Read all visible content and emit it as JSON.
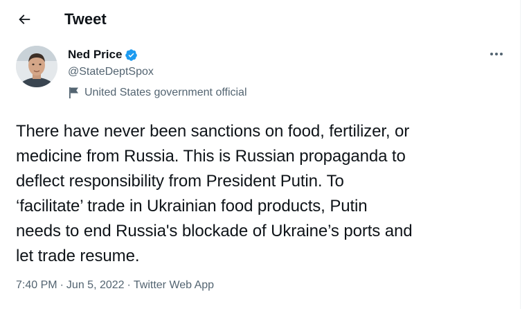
{
  "header": {
    "title": "Tweet"
  },
  "author": {
    "name": "Ned Price",
    "handle": "@StateDeptSpox",
    "label": "United States government official"
  },
  "tweet": {
    "text": "There have never been sanctions on food, fertilizer, or\nmedicine from Russia. This is Russian propaganda to\ndeflect responsibility from President Putin. To\n‘facilitate’ trade in Ukrainian food products, Putin\nneeds to end Russia's blockade of Ukraine’s ports and\nlet trade resume.",
    "time": "7:40 PM",
    "date": "Jun 5, 2022",
    "source": "Twitter Web App",
    "separator": "·"
  },
  "icons": {
    "back": "arrow-left-icon",
    "verified": "verified-badge-icon",
    "flag": "flag-icon",
    "more": "more-horizontal-icon"
  },
  "colors": {
    "verified_blue": "#1d9bf0",
    "secondary_text": "#536471",
    "primary_text": "#0f1419"
  }
}
